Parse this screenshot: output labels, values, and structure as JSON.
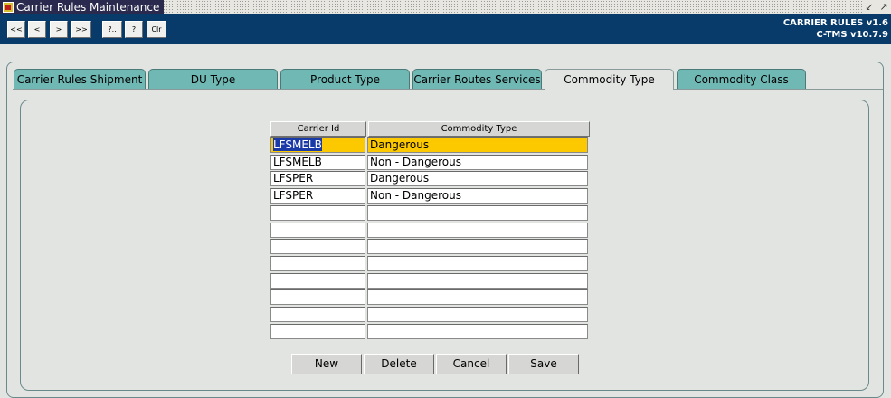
{
  "window": {
    "title": "Carrier Rules Maintenance",
    "controls": [
      "↙",
      "↗"
    ]
  },
  "toolbar": {
    "buttons": [
      "<<",
      "<",
      ">",
      ">>",
      "?..",
      "?",
      "Clr"
    ]
  },
  "version": {
    "line1": "CARRIER  RULES v1.6",
    "line2": "C-TMS v10.7.9"
  },
  "tabs": [
    {
      "label": "Carrier Rules Shipment",
      "active": false
    },
    {
      "label": "DU Type",
      "active": false
    },
    {
      "label": "Product Type",
      "active": false
    },
    {
      "label": "Carrier Routes Services",
      "active": false
    },
    {
      "label": "Commodity Type",
      "active": true
    },
    {
      "label": "Commodity Class",
      "active": false
    }
  ],
  "grid": {
    "columns": [
      "Carrier Id",
      "Commodity Type"
    ],
    "rows": [
      {
        "carrier_id": "LFSMELB",
        "commodity_type": "Dangerous",
        "selected": true
      },
      {
        "carrier_id": "LFSMELB",
        "commodity_type": "Non - Dangerous",
        "selected": false
      },
      {
        "carrier_id": "LFSPER",
        "commodity_type": "Dangerous",
        "selected": false
      },
      {
        "carrier_id": "LFSPER",
        "commodity_type": "Non - Dangerous",
        "selected": false
      },
      {
        "carrier_id": "",
        "commodity_type": "",
        "selected": false
      },
      {
        "carrier_id": "",
        "commodity_type": "",
        "selected": false
      },
      {
        "carrier_id": "",
        "commodity_type": "",
        "selected": false
      },
      {
        "carrier_id": "",
        "commodity_type": "",
        "selected": false
      },
      {
        "carrier_id": "",
        "commodity_type": "",
        "selected": false
      },
      {
        "carrier_id": "",
        "commodity_type": "",
        "selected": false
      },
      {
        "carrier_id": "",
        "commodity_type": "",
        "selected": false
      },
      {
        "carrier_id": "",
        "commodity_type": "",
        "selected": false
      }
    ]
  },
  "actions": {
    "new_label": "New",
    "delete_label": "Delete",
    "cancel_label": "Cancel",
    "save_label": "Save"
  },
  "colors": {
    "title_bg": "#2a2a4e",
    "toolbar_bg": "#083a6a",
    "tab_bg": "#70b8b4",
    "selected_row": "#fcc800",
    "selection_highlight": "#1a3aa8"
  }
}
